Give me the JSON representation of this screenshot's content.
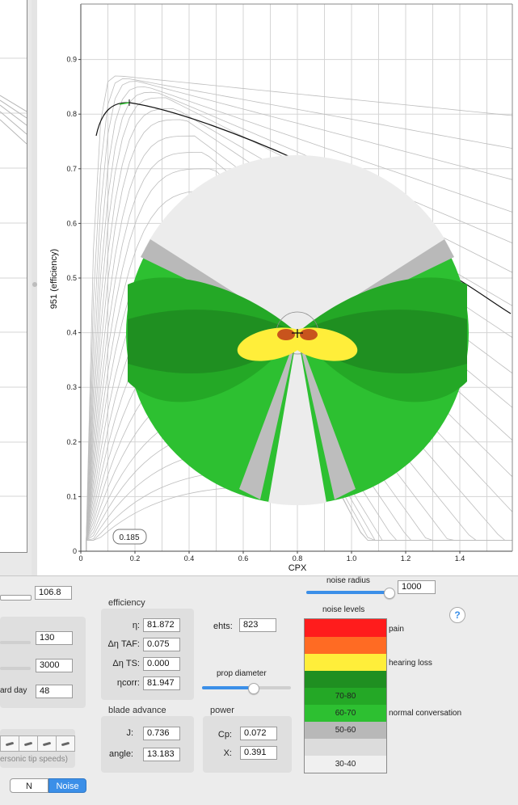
{
  "chart": {
    "y_axis_label": "951 (efficiency)",
    "x_axis_label": "CPX",
    "y_ticks": [
      "0",
      "0.1",
      "0.2",
      "0.3",
      "0.4",
      "0.5",
      "0.6",
      "0.7",
      "0.8",
      "0.9"
    ],
    "x_ticks": [
      "0",
      "0.2",
      "0.4",
      "0.6",
      "0.8",
      "1.0",
      "1.2",
      "1.4"
    ],
    "tooltip": "0.185"
  },
  "controls": {
    "top_value": "106.8",
    "value_130": "130",
    "value_3000": "3000",
    "standard_day_label": "ard day",
    "value_48": "48",
    "supersonic_label": "ersonic tip speeds)"
  },
  "efficiency": {
    "title": "efficiency",
    "eta_label": "η:",
    "eta_value": "81.872",
    "taf_label": "Δη TAF:",
    "taf_value": "0.075",
    "ts_label": "Δη TS:",
    "ts_value": "0.000",
    "corr_label": "ηcorr:",
    "corr_value": "81.947"
  },
  "ehts": {
    "label": "ehts:",
    "value": "823"
  },
  "prop_diameter": {
    "label": "prop diameter",
    "fraction": 0.57
  },
  "blade_advance": {
    "title": "blade advance",
    "j_label": "J:",
    "j_value": "0.736",
    "angle_label": "angle:",
    "angle_value": "13.183"
  },
  "power": {
    "title": "power",
    "cp_label": "Cp:",
    "cp_value": "0.072",
    "x_label": "X:",
    "x_value": "0.391"
  },
  "noise_radius": {
    "label": "noise radius",
    "value": "1000",
    "fraction": 0.95
  },
  "noise_levels": {
    "title": "noise levels",
    "help": "?",
    "bands": [
      {
        "label": "",
        "color": "#ff1c1c"
      },
      {
        "label": "",
        "color": "#ff6b23"
      },
      {
        "label": "",
        "color": "#ffee3a"
      },
      {
        "label": "",
        "color": "#1f8f21"
      },
      {
        "label": "70-80",
        "color": "#24a826"
      },
      {
        "label": "60-70",
        "color": "#2dc031"
      },
      {
        "label": "50-60",
        "color": "#b8b8b8"
      },
      {
        "label": "",
        "color": "#dcdcdc"
      },
      {
        "label": "30-40",
        "color": "#f0f0f0"
      }
    ],
    "notes": {
      "pain": "pain",
      "hearing_loss": "hearing loss",
      "normal_conversation": "normal conversation"
    }
  },
  "mode_toggle": {
    "n_label": "N",
    "noise_label": "Noise",
    "selected": "Noise"
  },
  "colors": {
    "accent": "#3b8fe8",
    "toggle_selected": "#3b8fe8"
  }
}
